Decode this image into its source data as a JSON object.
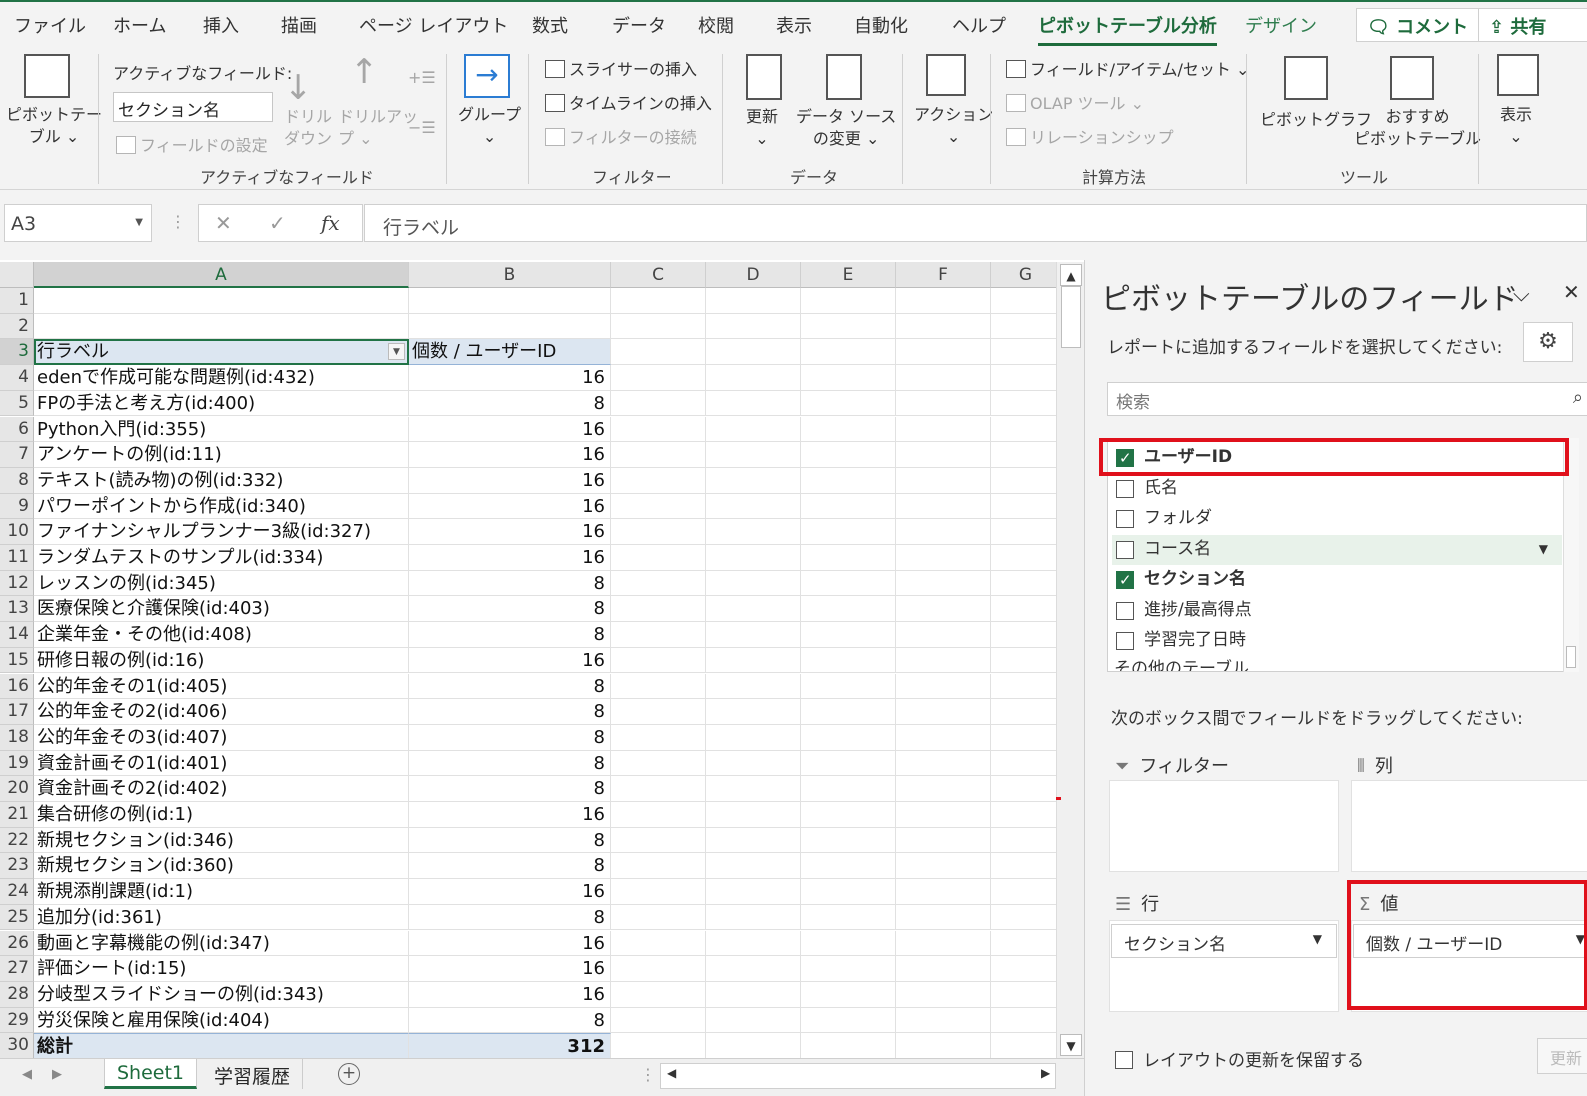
{
  "tabs": [
    "ファイル",
    "ホーム",
    "挿入",
    "描画",
    "ページ レイアウト",
    "数式",
    "データ",
    "校閲",
    "表示",
    "自動化",
    "ヘルプ",
    "ピボットテーブル分析",
    "デザイン"
  ],
  "header_buttons": {
    "comment": "コメント",
    "share": "共有"
  },
  "ribbon": {
    "pivot_table": [
      "ピボットテー",
      "ブル ⌄"
    ],
    "active_field_label": "アクティブなフィールド:",
    "active_field_value": "セクション名",
    "field_settings": "フィールドの設定",
    "drilldown": [
      "ドリル",
      "ダウン"
    ],
    "drillup": [
      "ドリルアッ",
      "プ ⌄"
    ],
    "group": "グループ",
    "insert_slicer": "スライサーの挿入",
    "insert_timeline": "タイムラインの挿入",
    "filter_connections": "フィルターの接続",
    "refresh": "更新",
    "change_source": [
      "データ ソース",
      "の変更 ⌄"
    ],
    "actions": "アクション",
    "fields_items_sets": "フィールド/アイテム/セット ⌄",
    "olap_tools": "OLAP ツール ⌄",
    "relationships": "リレーションシップ",
    "pivot_chart": "ピボットグラフ",
    "recommended": [
      "おすすめ",
      "ピボットテーブル"
    ],
    "show": "表示",
    "groups": {
      "active_field": "アクティブなフィールド",
      "filter": "フィルター",
      "data": "データ",
      "calculations": "計算方法",
      "tools": "ツール"
    }
  },
  "formula_bar": {
    "name_box": "A3",
    "formula": "行ラベル"
  },
  "columns": [
    "A",
    "B",
    "C",
    "D",
    "E",
    "F",
    "G"
  ],
  "pivot": {
    "row_label_header": "行ラベル",
    "value_header": "個数 / ユーザーID",
    "rows": [
      {
        "label": "edenで作成可能な問題例(id:432)",
        "value": 16
      },
      {
        "label": "FPの手法と考え方(id:400)",
        "value": 8
      },
      {
        "label": "Python入門(id:355)",
        "value": 16
      },
      {
        "label": "アンケートの例(id:11)",
        "value": 16
      },
      {
        "label": "テキスト(読み物)の例(id:332)",
        "value": 16
      },
      {
        "label": "パワーポイントから作成(id:340)",
        "value": 16
      },
      {
        "label": "ファイナンシャルプランナー3級(id:327)",
        "value": 16
      },
      {
        "label": "ランダムテストのサンプル(id:334)",
        "value": 16
      },
      {
        "label": "レッスンの例(id:345)",
        "value": 8
      },
      {
        "label": "医療保険と介護保険(id:403)",
        "value": 8
      },
      {
        "label": "企業年金・その他(id:408)",
        "value": 8
      },
      {
        "label": "研修日報の例(id:16)",
        "value": 16
      },
      {
        "label": "公的年金その1(id:405)",
        "value": 8
      },
      {
        "label": "公的年金その2(id:406)",
        "value": 8
      },
      {
        "label": "公的年金その3(id:407)",
        "value": 8
      },
      {
        "label": "資金計画その1(id:401)",
        "value": 8
      },
      {
        "label": "資金計画その2(id:402)",
        "value": 8
      },
      {
        "label": "集合研修の例(id:1)",
        "value": 16
      },
      {
        "label": "新規セクション(id:346)",
        "value": 8
      },
      {
        "label": "新規セクション(id:360)",
        "value": 8
      },
      {
        "label": "新規添削課題(id:1)",
        "value": 16
      },
      {
        "label": "追加分(id:361)",
        "value": 8
      },
      {
        "label": "動画と字幕機能の例(id:347)",
        "value": 16
      },
      {
        "label": "評価シート(id:15)",
        "value": 16
      },
      {
        "label": "分岐型スライドショーの例(id:343)",
        "value": 16
      },
      {
        "label": "労災保険と雇用保険(id:404)",
        "value": 8
      }
    ],
    "total_label": "総計",
    "total_value": 312
  },
  "sheets": [
    "Sheet1",
    "学習履歴"
  ],
  "pane": {
    "title": "ピボットテーブルのフィールド",
    "subtitle": "レポートに追加するフィールドを選択してください:",
    "search_placeholder": "検索",
    "fields": [
      {
        "name": "ユーザーID",
        "checked": true
      },
      {
        "name": "氏名",
        "checked": false
      },
      {
        "name": "フォルダ",
        "checked": false
      },
      {
        "name": "コース名",
        "checked": false
      },
      {
        "name": "セクション名",
        "checked": true
      },
      {
        "name": "進捗/最高得点",
        "checked": false
      },
      {
        "name": "学習完了日時",
        "checked": false
      },
      {
        "name": "その他のテーブル...",
        "checked": false
      }
    ],
    "drag_label": "次のボックス間でフィールドをドラッグしてください:",
    "zones": {
      "filter": "フィルター",
      "columns": "列",
      "rows": "行",
      "values": "値"
    },
    "row_item": "セクション名",
    "value_item": "個数 / ユーザーID",
    "defer_label": "レイアウトの更新を保留する",
    "update_button": "更新"
  },
  "colors": {
    "accent": "#217346",
    "highlight_box": "#e0101b",
    "pivot_header": "#dce6f1"
  }
}
